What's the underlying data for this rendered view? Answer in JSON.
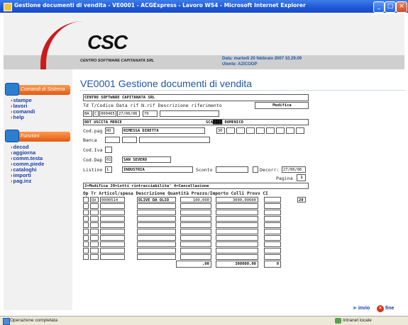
{
  "window": {
    "title": "Gestione documenti di vendita - VE0001 - ACGExpress - Lavoro WS4 - Microsoft Internet Explorer"
  },
  "header": {
    "logo_text": "CSC",
    "logo_subtitle": "CENTRO SOFTWARE CAPITANATA SRL",
    "date_line": "Data:   martedì 20 febbraio 2007 10.29.09",
    "user_line": "Utente: AZICOOP"
  },
  "sidebar": {
    "system_heading": "Comandi di Sistema",
    "system_links": [
      "stampe",
      "lavori",
      "comandi",
      "help"
    ],
    "functions_heading": "Funzioni",
    "function_links": [
      "decod",
      "aggiorna",
      "comm.testa",
      "comm.piede",
      "cataloghi",
      "importi",
      "pag.inz"
    ]
  },
  "main": {
    "title": "VE0001 Gestione documenti di vendita",
    "company": "CENTRO SOFTWARE CAPITANATA SRL",
    "doc_header_labels": "Td T/Codice Data rif N.rif Descrizione riferimento",
    "mode": "Modifica",
    "doc_td": "BA",
    "doc_t": "C",
    "doc_code": "000465",
    "doc_date": "27/06/06",
    "doc_nrif": "79",
    "doc_type_desc": "DDT USCITA MERCE",
    "customer": "SCA████ DOMENICO",
    "codpag_label": "Cod.pag",
    "codpag": "RD",
    "codpag_desc": "RIMESSA DIRETTA",
    "codpag_days": "30",
    "banca_label": "Banca",
    "codiva_label": "Cod.Iva",
    "coddep_label": "Cod.Dep",
    "coddep": "01",
    "coddep_desc": "SAN SEVERO",
    "listino_label": "Listino",
    "listino": "1",
    "listino_desc": "INDUSTRIA",
    "sconto_label": "Sconto",
    "decorr_label": "Decorr:",
    "decorr": "27/06/06",
    "pagina_label": "Pagina",
    "pagina": "1",
    "legend": "2=Modifica  20=Lotti rintracciabilita' 4=Cancellazione",
    "table_headers": "Op Tr Articol/spesa Descrizione       Quantità  Prezzo/Importo  Colli Provv CI",
    "row1": {
      "tr": "QV",
      "article": "0000514",
      "description": "OLIVE DA OLIO",
      "quantity": "100,000",
      "price": "3000,00000",
      "ci": "20"
    },
    "totals": {
      "quantity": ",00",
      "amount": "300000,00",
      "colli": "0"
    }
  },
  "footer": {
    "invio": "invio",
    "fine": "fine"
  },
  "statusbar": {
    "status": "Operazione completata",
    "zone": "Intranet locale"
  }
}
